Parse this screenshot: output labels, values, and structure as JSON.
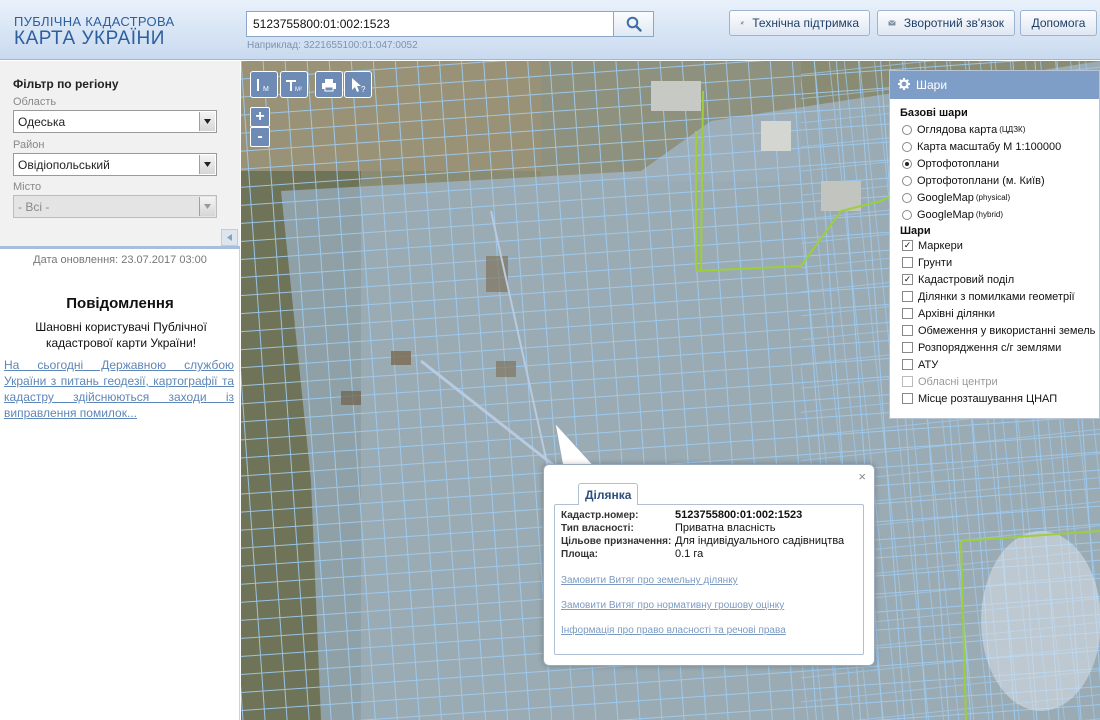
{
  "header": {
    "logo_line1": "ПУБЛІЧНА КАДАСТРОВА",
    "logo_line2": "КАРТА УКРАЇНИ",
    "search_value": "5123755800:01:002:1523",
    "search_hint": "Наприклад: 3221655100:01:047:0052",
    "buttons": {
      "support": "Технічна підтримка",
      "feedback": "Зворотний зв'язок",
      "help": "Допомога"
    }
  },
  "sidebar": {
    "filter_title": "Фільтр по регіону",
    "oblast_label": "Область",
    "oblast_value": "Одеська",
    "raion_label": "Район",
    "raion_value": "Овідіопольський",
    "misto_label": "Місто",
    "misto_value": "- Всі -",
    "update_date": "Дата оновлення: 23.07.2017 03:00",
    "notice_title": "Повідомлення",
    "notice_text": "Шановні користувачі Публічної кадастрової карти України!",
    "notice_link": "На сьогодні Державною службою України з питань геодезії, картографії та кадастру здійснюються заходи із виправлення помилок..."
  },
  "map_tools": {
    "zoom_in": "+",
    "zoom_out": "-"
  },
  "layers": {
    "title": "Шари",
    "base_title": "Базові шари",
    "base": [
      {
        "label": "Оглядова карта",
        "sup": "(ЦДЗК)",
        "selected": false
      },
      {
        "label": "Карта масштабу М 1:100000",
        "sup": "",
        "selected": false
      },
      {
        "label": "Ортофотоплани",
        "sup": "",
        "selected": true
      },
      {
        "label": "Ортофотоплани (м. Київ)",
        "sup": "",
        "selected": false
      },
      {
        "label": "GoogleMap",
        "sup": "(physical)",
        "selected": false
      },
      {
        "label": "GoogleMap",
        "sup": "(hybrid)",
        "selected": false
      }
    ],
    "overlay_title": "Шари",
    "overlays": [
      {
        "label": "Маркери",
        "checked": true,
        "disabled": false
      },
      {
        "label": "Грунти",
        "checked": false,
        "disabled": false
      },
      {
        "label": "Кадастровий поділ",
        "checked": true,
        "disabled": false
      },
      {
        "label": "Ділянки з помилками геометрії",
        "checked": false,
        "disabled": false
      },
      {
        "label": "Архівні ділянки",
        "checked": false,
        "disabled": false
      },
      {
        "label": "Обмеження у використанні земель",
        "checked": false,
        "disabled": false
      },
      {
        "label": "Розпорядження с/г землями",
        "checked": false,
        "disabled": false
      },
      {
        "label": "АТУ",
        "checked": false,
        "disabled": false
      },
      {
        "label": "Обласні центри",
        "checked": false,
        "disabled": true
      },
      {
        "label": "Місце розташування ЦНАП",
        "checked": false,
        "disabled": false
      }
    ]
  },
  "popup": {
    "tab": "Ділянка",
    "close": "×",
    "fields": [
      {
        "label": "Кадастр.номер:",
        "value": "5123755800:01:002:1523",
        "bold": true
      },
      {
        "label": "Тип власності:",
        "value": "Приватна власність",
        "bold": false
      },
      {
        "label": "Цільове призначення:",
        "value": "Для індивідуального садівництва",
        "bold": false
      },
      {
        "label": "Площа:",
        "value": "0.1 га",
        "bold": false
      }
    ],
    "links": [
      "Замовити Витяг про земельну ділянку",
      "Замовити Витяг про нормативну грошову оцінку",
      "Інформація про право власності та речові права"
    ]
  },
  "colors": {
    "brand": "#2c5f9e",
    "parcel_line": "#8ec0ee",
    "boundary": "#9ccf3a"
  }
}
